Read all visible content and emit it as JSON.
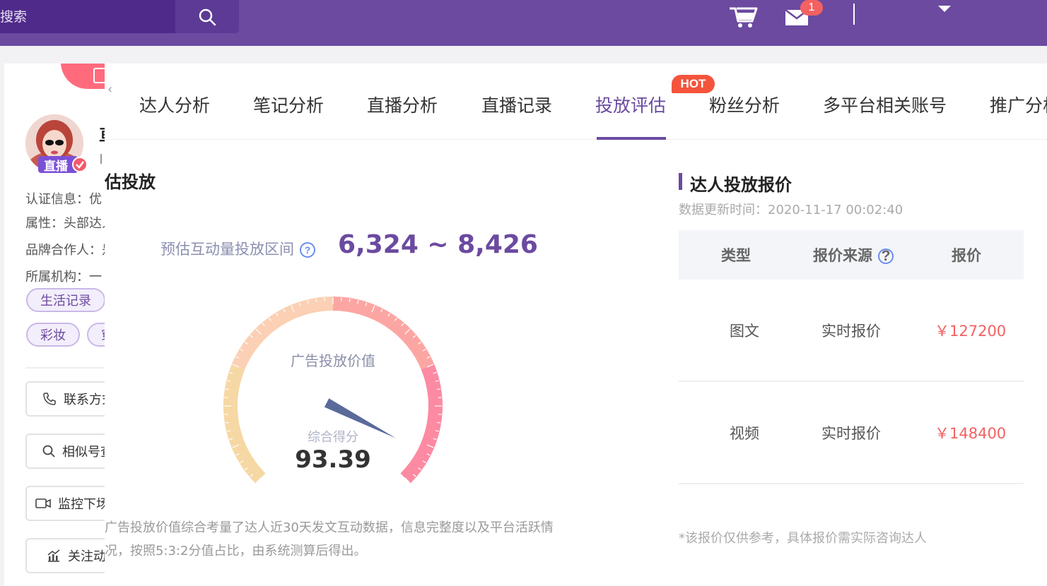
{
  "topbar": {
    "search_placeholder": "搜索",
    "mail_count": "1"
  },
  "profile": {
    "name_fragment": "亘",
    "live_badge": "直播",
    "info": [
      {
        "label": "认证信息：优"
      },
      {
        "label": "属性：头部达人"
      },
      {
        "label": "品牌合作人：是"
      },
      {
        "label": "所属机构：一"
      }
    ],
    "tags": [
      "生活记录",
      "彩妆",
      "穿"
    ],
    "actions": [
      {
        "label": "联系方式"
      },
      {
        "label": "相似号查找"
      },
      {
        "label": "监控下场"
      },
      {
        "label": "关注动态"
      }
    ]
  },
  "tabs": [
    {
      "label": "达人分析"
    },
    {
      "label": "笔记分析"
    },
    {
      "label": "直播分析"
    },
    {
      "label": "直播记录"
    },
    {
      "label": "投放评估",
      "active": true
    },
    {
      "label": "粉丝分析"
    },
    {
      "label": "多平台相关账号"
    },
    {
      "label": "推广分析"
    }
  ],
  "hot_badge": "HOT",
  "evaluation": {
    "section_title": "估投放",
    "range_label": "预估互动量投放区间",
    "range_value": "6,324 ~ 8,426",
    "gauge_title": "广告投放价值",
    "gauge_sub": "综合得分",
    "score": "93.39",
    "score_value": 93.39,
    "desc_line1": "广告投放价值综合考量了达人近30天发文互动数据，信息完整度以及平台活跃情",
    "desc_line2": "况，按照5:3:2分值占比，由系统测算后得出。"
  },
  "pricing": {
    "title": "达人投放报价",
    "update_time": "数据更新时间：2020-11-17 00:02:40",
    "headers": {
      "type": "类型",
      "source": "报价来源",
      "price": "报价"
    },
    "rows": [
      {
        "type": "图文",
        "source": "实时报价",
        "price": "￥127200"
      },
      {
        "type": "视频",
        "source": "实时报价",
        "price": "￥148400"
      }
    ],
    "note": "*该报价仅供参考，具体报价需实际咨询达人"
  },
  "colors": {
    "brand": "#6b4aa0",
    "price": "#f46161",
    "gauge_segments": [
      "#f6d8a4",
      "#fbd0b4",
      "#fca6a3",
      "#fc8aa2"
    ]
  }
}
